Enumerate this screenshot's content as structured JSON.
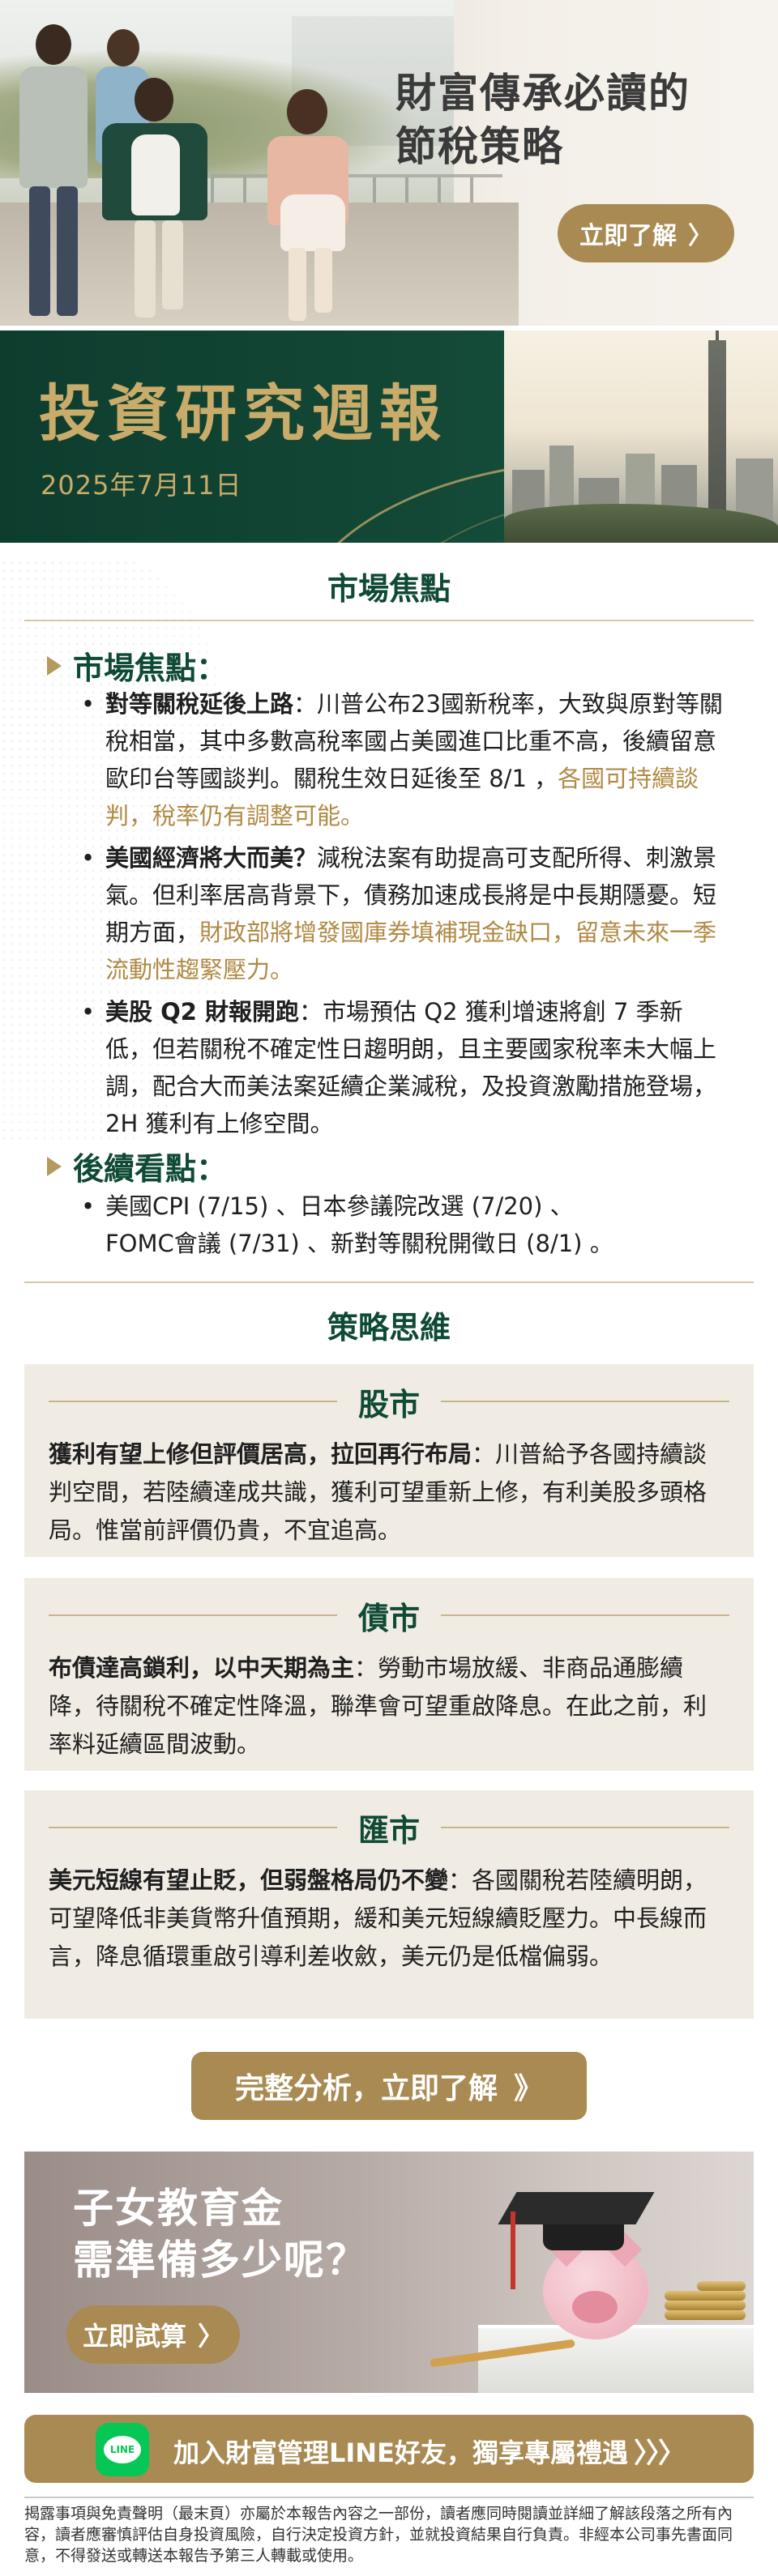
{
  "hero": {
    "title": "財富傳承必讀的\n節稅策略",
    "button_label": "立即了解",
    "button_chevron": "〉"
  },
  "report": {
    "title": "投資研究週報",
    "date": "2025年7月11日"
  },
  "market_focus": {
    "section_title": "市場焦點",
    "subhead": "市場焦點：",
    "bullets": [
      {
        "bold": "對等關稅延後上路",
        "text": "：川普公布23國新稅率，大致與原對等關稅相當，其中多數高稅率國占美國進口比重不高，後續留意歐印台等國談判。關稅生效日延後至 8/1 ，",
        "highlight": "各國可持續談判，稅率仍有調整可能。",
        "tail": ""
      },
      {
        "bold": "美國經濟將大而美？",
        "text": "減稅法案有助提高可支配所得、刺激景氣。但利率居高背景下，債務加速成長將是中長期隱憂。短期方面，",
        "highlight": "財政部將增發國庫券填補現金缺口，留意未來一季流動性趨緊壓力。",
        "tail": ""
      },
      {
        "bold": "美股 Q2 財報開跑",
        "text": "：市場預估 Q2 獲利增速將創 7 季新低，但若關稅不確定性日趨明朗，且主要國家稅率未大幅上調，配合大而美法案延續企業減稅，及投資激勵措施登場， 2H 獲利有上修空間。",
        "highlight": "",
        "tail": ""
      }
    ],
    "followup_subhead": "後續看點：",
    "followup_line1": "美國CPI (7/15) 、日本參議院改選 (7/20) 、",
    "followup_line2": "FOMC會議 (7/31) 、新對等關稅開徵日 (8/1) 。"
  },
  "strategy": {
    "section_title": "策略思維",
    "cards": [
      {
        "title": "股市",
        "bold": "獲利有望上修但評價居高，拉回再行布局",
        "text": "：川普給予各國持續談判空間，若陸續達成共識，獲利可望重新上修，有利美股多頭格局。惟當前評價仍貴，不宜追高。"
      },
      {
        "title": "債市",
        "bold": "布債達高鎖利，以中天期為主",
        "text": "：勞動市場放緩、非商品通膨續降，待關稅不確定性降溫，聯準會可望重啟降息。在此之前，利率料延續區間波動。"
      },
      {
        "title": "匯市",
        "bold": "美元短線有望止貶，但弱盤格局仍不變",
        "text": "：各國關稅若陸續明朗，可望降低非美貨幣升值預期，緩和美元短線續貶壓力。中長線而言，降息循環重啟引導利差收斂，美元仍是低檔偏弱。"
      }
    ]
  },
  "cta": {
    "label": "完整分析，立即了解",
    "chevron": "》"
  },
  "education_banner": {
    "title": "子女教育金\n需準備多少呢？",
    "button_label": "立即試算",
    "button_chevron": "〉"
  },
  "line_bar": {
    "icon_text": "LINE",
    "label": "加入財富管理LINE好友，獨享專屬禮遇",
    "arrows": "〉〉〉"
  },
  "disclaimer": "揭露事項與免責聲明（最末頁）亦屬於本報告內容之一部份，讀者應同時閱讀並詳細了解該段落之所有內容，讀者應審慎評估自身投資風險，自行決定投資方針，並就投資結果自行負責。非經本公司事先書面同意，不得發送或轉送本報告予第三人轉載或使用。",
  "colors": {
    "brand_green": "#0f4a35",
    "gold": "#a98a52",
    "highlight_gold": "#b08a44",
    "card_bg": "#f1ece3",
    "line_green": "#06c755"
  }
}
